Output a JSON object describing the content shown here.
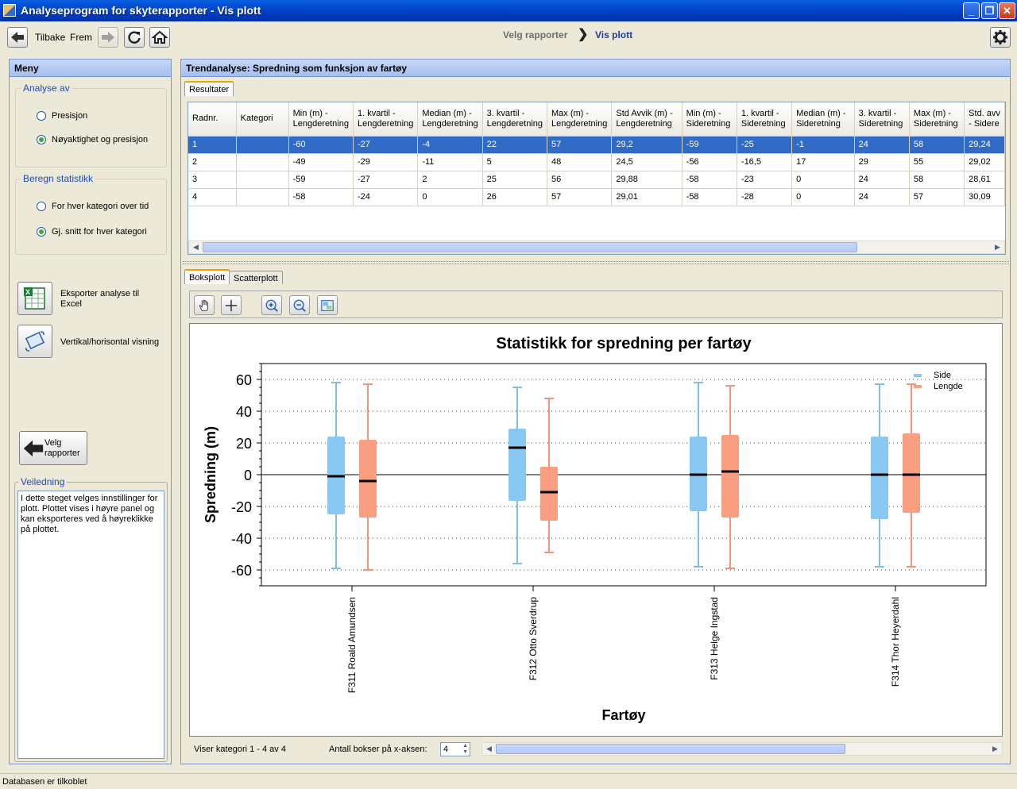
{
  "window": {
    "title": "Analyseprogram for skyterapporter - Vis plott"
  },
  "toolbar": {
    "back_label": "Tilbake",
    "forward_label": "Frem",
    "crumbs": [
      "Velg rapporter",
      "Vis plott"
    ]
  },
  "menu": {
    "title": "Meny",
    "analysis_group": "Analyse av",
    "analysis_options": [
      "Presisjon",
      "Nøyaktighet og presisjon"
    ],
    "analysis_selected": 1,
    "stats_group": "Beregn statistikk",
    "stats_options": [
      "For hver kategori over tid",
      "Gj. snitt for hver kategori"
    ],
    "stats_selected": 1,
    "export_label": "Eksporter analyse til Excel",
    "view_label": "Vertikal/horisontal visning",
    "back_reports_label": "Velg rapporter",
    "help_title": "Veiledning",
    "help_text": "I dette steget velges innstillinger for plott. Plottet vises i høyre panel og kan eksporteres ved å høyreklikke på plottet."
  },
  "main": {
    "title": "Trendanalyse: Spredning som funksjon av fartøy",
    "results_tab": "Resultater",
    "columns": [
      "Radnr.",
      "Kategori",
      "Min (m) -\nLengderetning",
      "1. kvartil -\nLengderetning",
      "Median (m) -\nLengderetning",
      "3. kvartil -\nLengderetning",
      "Max (m) -\nLengderetning",
      "Std Avvik (m) -\nLengderetning",
      "Min (m) -\nSideretning",
      "1. kvartil -\nSideretning",
      "Median (m) -\nSideretning",
      "3. kvartil -\nSideretning",
      "Max (m) -\nSideretning",
      "Std. avv\n- Sidere"
    ],
    "rows": [
      [
        "1",
        "",
        "-60",
        "-27",
        "-4",
        "22",
        "57",
        "29,2",
        "-59",
        "-25",
        "-1",
        "24",
        "58",
        "29,24"
      ],
      [
        "2",
        "",
        "-49",
        "-29",
        "-11",
        "5",
        "48",
        "24,5",
        "-56",
        "-16,5",
        "17",
        "29",
        "55",
        "29,02"
      ],
      [
        "3",
        "",
        "-59",
        "-27",
        "2",
        "25",
        "56",
        "29,88",
        "-58",
        "-23",
        "0",
        "24",
        "58",
        "28,61"
      ],
      [
        "4",
        "",
        "-58",
        "-24",
        "0",
        "26",
        "57",
        "29,01",
        "-58",
        "-28",
        "0",
        "24",
        "57",
        "30,09"
      ]
    ],
    "selected_row": 0,
    "plot_tabs": [
      "Boksplott",
      "Scatterplott"
    ],
    "plot_tools": [
      "hand-icon",
      "crosshair-icon",
      "zoom-in-icon",
      "zoom-out-icon",
      "reset-view-icon"
    ],
    "category_info": "Viser kategori 1 - 4 av 4",
    "boxes_label": "Antall bokser på x-aksen:",
    "boxes_value": "4"
  },
  "chart_data": {
    "type": "boxplot",
    "title": "Statistikk for spredning per fartøy",
    "xlabel": "Fartøy",
    "ylabel": "Spredning (m)",
    "ylim": [
      -70,
      70
    ],
    "yticks": [
      60,
      40,
      20,
      0,
      -20,
      -40,
      -60
    ],
    "grid": true,
    "legend_position": "top-right",
    "categories": [
      "F311 Roald Amundsen",
      "F312 Otto Sverdrup",
      "F313 Helge Ingstad",
      "F314 Thor Heyerdahl"
    ],
    "series": [
      {
        "name": "Side",
        "color": "#88c8f2",
        "whisker_color": "#7dbfe9",
        "min": [
          -59,
          -56,
          -58,
          -58
        ],
        "q1": [
          -25,
          -16.5,
          -23,
          -28
        ],
        "median": [
          -1,
          17,
          0,
          0
        ],
        "q3": [
          24,
          29,
          24,
          24
        ],
        "max": [
          58,
          55,
          58,
          57
        ]
      },
      {
        "name": "Lengde",
        "color": "#fa9e82",
        "whisker_color": "#f2937a",
        "min": [
          -60,
          -49,
          -59,
          -58
        ],
        "q1": [
          -27,
          -29,
          -27,
          -24
        ],
        "median": [
          -4,
          -11,
          2,
          0
        ],
        "q3": [
          22,
          5,
          25,
          26
        ],
        "max": [
          57,
          48,
          56,
          57
        ]
      }
    ]
  },
  "statusbar": {
    "text": "Databasen er tilkoblet"
  }
}
